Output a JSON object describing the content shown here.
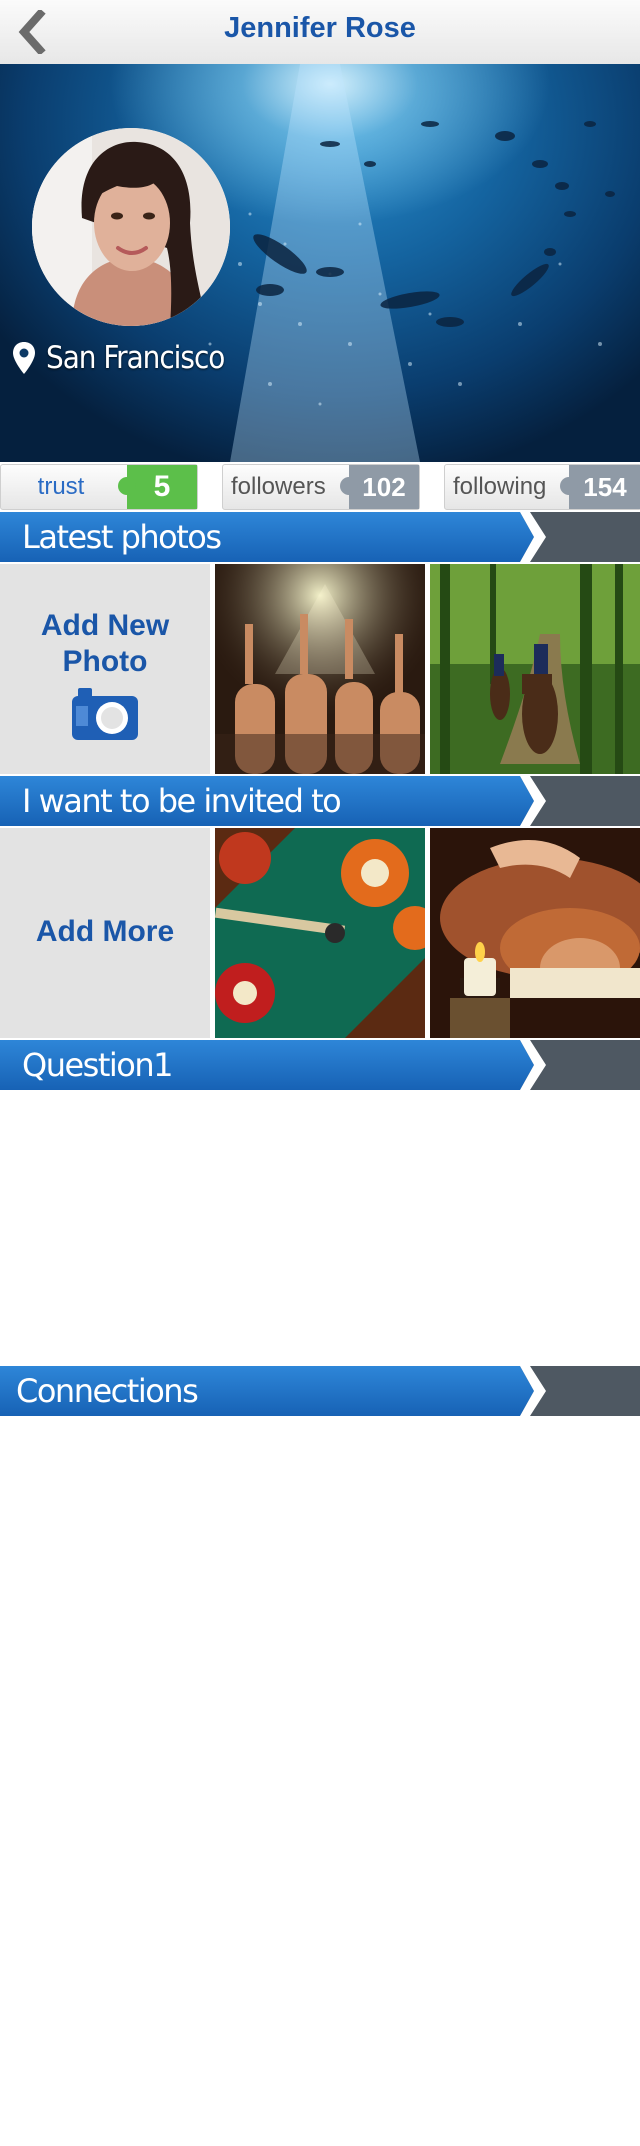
{
  "header": {
    "title": "Jennifer Rose",
    "back_icon": "chevron-left-icon"
  },
  "profile": {
    "location": "San Francisco",
    "location_icon": "map-pin-icon"
  },
  "stats": [
    {
      "label": "trust",
      "value": "5"
    },
    {
      "label": "followers",
      "value": "102"
    },
    {
      "label": "following",
      "value": "154"
    }
  ],
  "sections": {
    "latest_photos": {
      "title": "Latest photos",
      "add_label_1": "Add New",
      "add_label_2": "Photo",
      "add_icon": "camera-icon"
    },
    "invited": {
      "title": "I want to be invited to",
      "add_label": "Add More"
    },
    "question": {
      "title": "Question1"
    },
    "connections": {
      "title": "Connections"
    }
  },
  "colors": {
    "brand_blue": "#1a56a8",
    "bar_blue": "#1f6fc6",
    "trust_green": "#5cbf4a",
    "count_grey": "#8f9aa6",
    "bar_dark": "#4e5862"
  }
}
